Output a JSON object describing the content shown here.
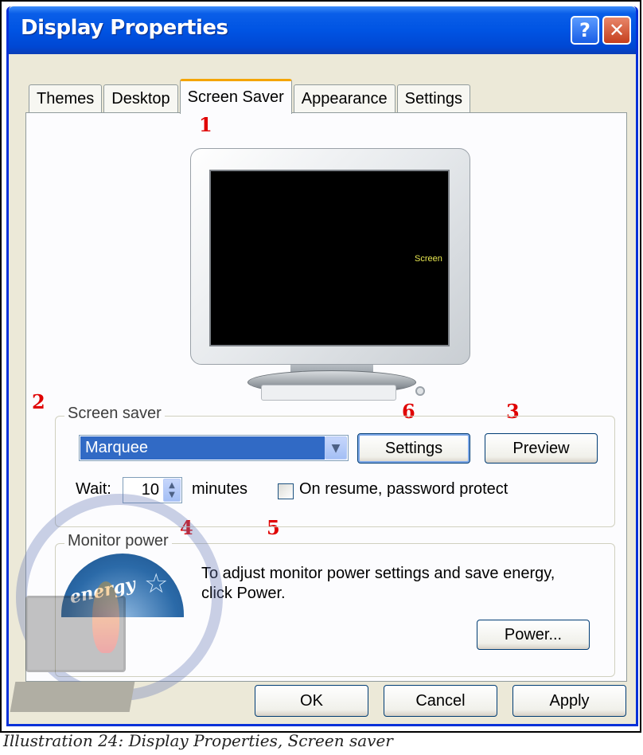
{
  "window": {
    "title": "Display Properties",
    "help_label": "?",
    "close_label": "✕"
  },
  "tabs": [
    {
      "label": "Themes",
      "active": false
    },
    {
      "label": "Desktop",
      "active": false
    },
    {
      "label": "Screen Saver",
      "active": true
    },
    {
      "label": "Appearance",
      "active": false
    },
    {
      "label": "Settings",
      "active": false
    }
  ],
  "preview": {
    "screen_text": "Screen"
  },
  "annotations": {
    "a1": "1",
    "a2": "2",
    "a3": "3",
    "a4": "4",
    "a5": "5",
    "a6": "6"
  },
  "screen_saver_group": {
    "legend": "Screen saver",
    "selected": "Marquee",
    "settings_label": "Settings",
    "preview_label": "Preview",
    "wait_label": "Wait:",
    "wait_value": "10",
    "minutes_label": "minutes",
    "password_label": "On resume, password protect",
    "password_checked": false
  },
  "monitor_power_group": {
    "legend": "Monitor power",
    "description_line1": "To adjust monitor power settings and save energy,",
    "description_line2": "click Power.",
    "power_label": "Power...",
    "logo_text": "energy"
  },
  "footer": {
    "ok_label": "OK",
    "cancel_label": "Cancel",
    "apply_label": "Apply"
  },
  "caption": "Illustration 24: Display Properties, Screen saver",
  "colors": {
    "titlebar": "#0054e3",
    "dialog_bg": "#ece9d8",
    "selection": "#316ac5",
    "annotation": "#e00000",
    "active_tab_accent": "#f4a500"
  }
}
